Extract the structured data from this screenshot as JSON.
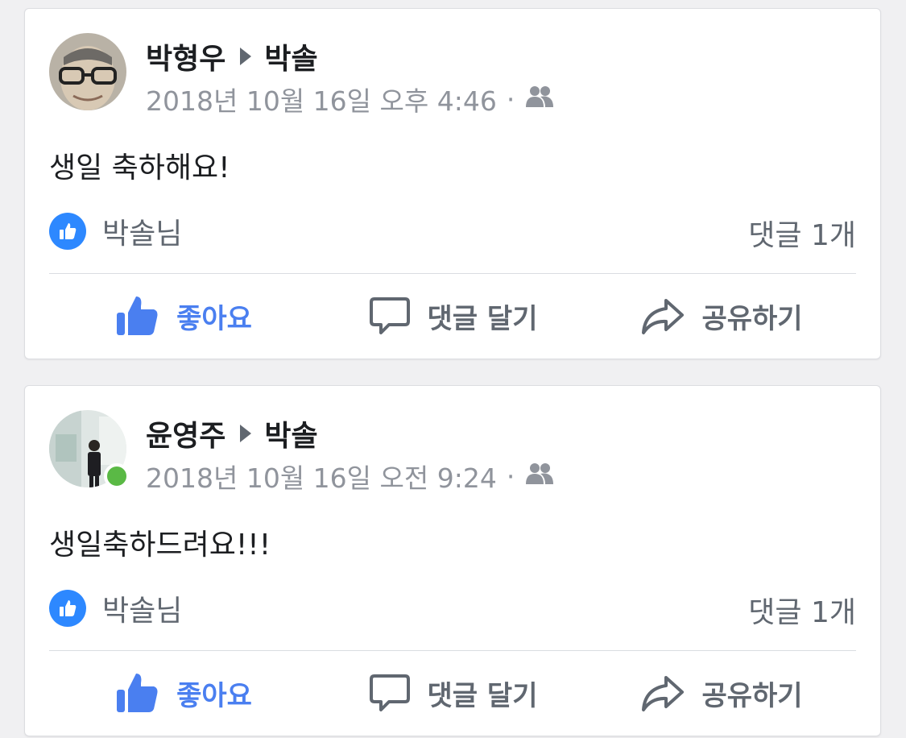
{
  "posts": [
    {
      "author": "박형우",
      "target": "박솔",
      "timestamp": "2018년 10월 16일 오후 4:46",
      "separator": "·",
      "privacy_icon": "friends-icon",
      "text": "생일 축하해요!",
      "reactors": "박솔님",
      "comments": "댓글 1개",
      "online": false
    },
    {
      "author": "윤영주",
      "target": "박솔",
      "timestamp": "2018년 10월 16일 오전 9:24",
      "separator": "·",
      "privacy_icon": "friends-icon",
      "text": "생일축하드려요!!!",
      "reactors": "박솔님",
      "comments": "댓글 1개",
      "online": true
    }
  ],
  "actions": {
    "like": "좋아요",
    "comment": "댓글 달기",
    "share": "공유하기"
  },
  "colors": {
    "like_blue": "#4a7ff0",
    "reaction_badge": "#2d88ff",
    "online_green": "#5ab945",
    "meta_gray": "#90949c"
  }
}
